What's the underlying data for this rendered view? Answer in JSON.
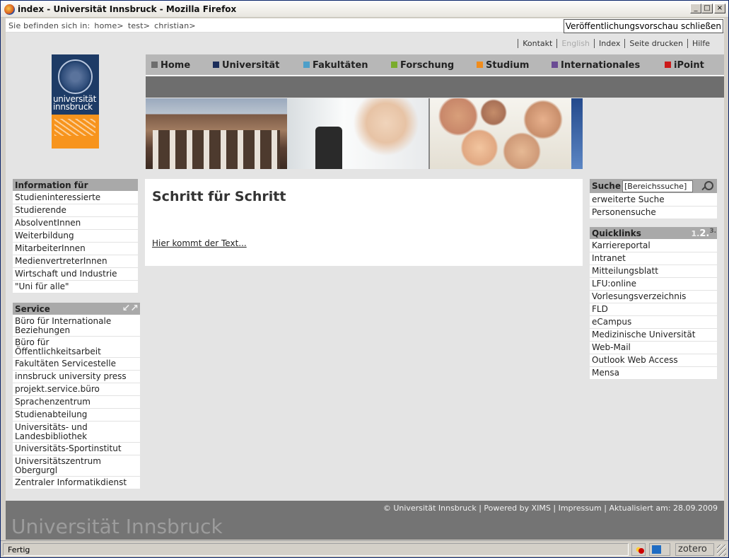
{
  "window": {
    "title": "index - Universität Innsbruck - Mozilla Firefox",
    "buttons": [
      "_",
      "□",
      "×"
    ]
  },
  "breadcrumb": {
    "prefix": "Sie befinden sich in:",
    "items": [
      "home>",
      "test>",
      "christian>"
    ]
  },
  "preview_button": "Veröffentlichungsvorschau schließen",
  "toplinks": [
    "Kontakt",
    "English",
    "Index",
    "Seite drucken",
    "Hilfe"
  ],
  "logo": {
    "line1": "universität",
    "line2": "innsbruck"
  },
  "nav": [
    {
      "label": "Home",
      "color": "#6d6d6d"
    },
    {
      "label": "Universität",
      "color": "#1b2d5a"
    },
    {
      "label": "Fakultäten",
      "color": "#4d9fc9"
    },
    {
      "label": "Forschung",
      "color": "#7aac2c"
    },
    {
      "label": "Studium",
      "color": "#f08c1c"
    },
    {
      "label": "Internationales",
      "color": "#6a4b94"
    },
    {
      "label": "iPoint",
      "color": "#cc1a1a"
    }
  ],
  "info_box": {
    "title": "Information für",
    "items": [
      "Studieninteressierte",
      "Studierende",
      "AbsolventInnen",
      "Weiterbildung",
      "MitarbeiterInnen",
      "MedienvertreterInnen",
      "Wirtschaft und Industrie",
      "\"Uni für alle\""
    ]
  },
  "service_box": {
    "title": "Service",
    "icon": "expand-arrows-icon",
    "items": [
      "Büro für Internationale Beziehungen",
      "Büro für Öffentlichkeitsarbeit",
      "Fakultäten Servicestelle",
      "innsbruck university press",
      "projekt.service.büro",
      "Sprachenzentrum",
      "Studienabteilung",
      "Universitäts- und Landesbibliothek",
      "Universitäts-Sportinstitut",
      "Universitätszentrum Obergurgl",
      "Zentraler Informatikdienst"
    ]
  },
  "content": {
    "heading": "Schritt für Schritt",
    "link": "Hier kommt der Text..."
  },
  "search_box": {
    "title": "Suche",
    "input_value": "[Bereichssuche]",
    "links": [
      "erweiterte Suche",
      "Personensuche"
    ]
  },
  "quicklinks": {
    "title": "Quicklinks",
    "font_sizes": [
      "1.",
      "2.",
      "3."
    ],
    "items": [
      "Karriereportal",
      "Intranet",
      "Mitteilungsblatt",
      "LFU:online",
      "Vorlesungsverzeichnis",
      "FLD",
      "eCampus",
      "Medizinische Universität",
      "Web-Mail",
      "Outlook Web Access",
      "Mensa"
    ]
  },
  "footer": {
    "meta": "© Universität Innsbruck | Powered by XIMS | Impressum | Aktualisiert am: 28.09.2009",
    "brand": "Universität Innsbruck"
  },
  "statusbar": {
    "status": "Fertig",
    "zotero": "zotero"
  }
}
